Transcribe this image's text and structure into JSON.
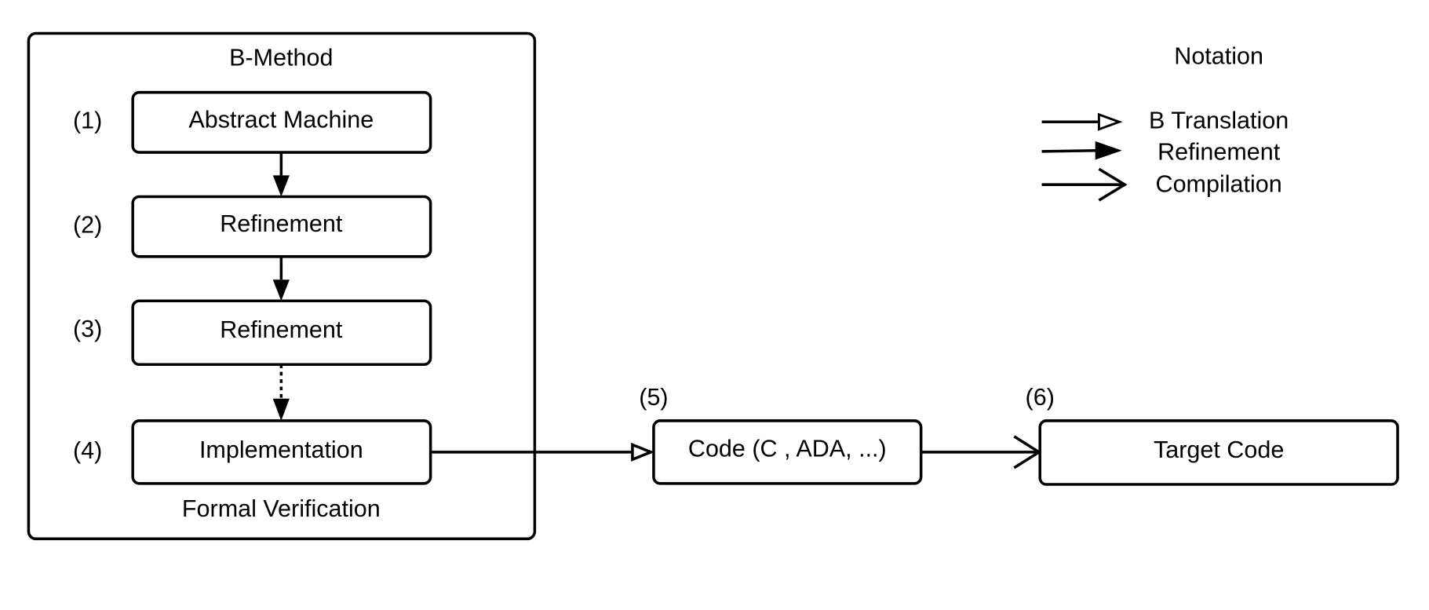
{
  "group": {
    "title": "B-Method",
    "footer": "Formal Verification"
  },
  "steps": [
    {
      "number": "(1)",
      "label": "Abstract Machine"
    },
    {
      "number": "(2)",
      "label": "Refinement"
    },
    {
      "number": "(3)",
      "label": "Refinement"
    },
    {
      "number": "(4)",
      "label": "Implementation"
    },
    {
      "number": "(5)",
      "label": "Code (C , ADA, ...)"
    },
    {
      "number": "(6)",
      "label": "Target Code"
    }
  ],
  "notation": {
    "title": "Notation",
    "items": [
      {
        "label": "B Translation",
        "arrow": "hollow-triangle"
      },
      {
        "label": "Refinement",
        "arrow": "filled-triangle"
      },
      {
        "label": "Compilation",
        "arrow": "open-chevron"
      }
    ]
  }
}
